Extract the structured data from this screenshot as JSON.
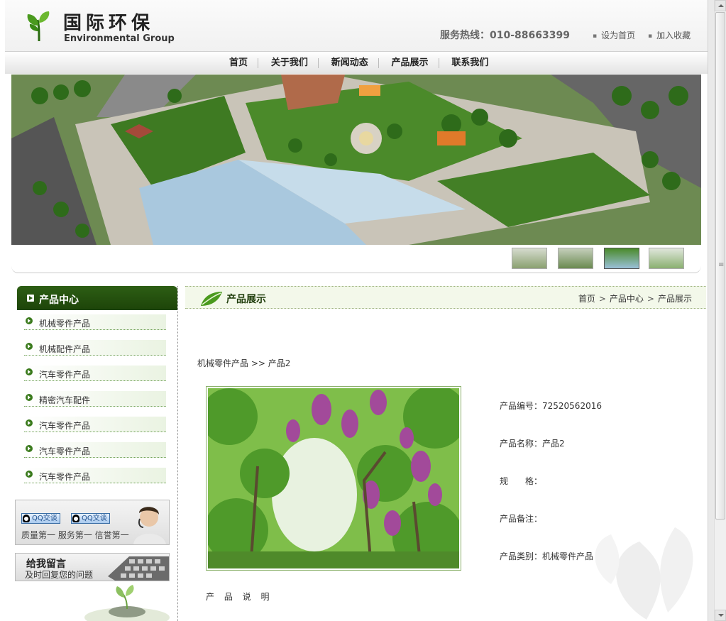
{
  "header": {
    "brand_cn": "国际环保",
    "brand_en": "Environmental Group",
    "hotline": "服务热线：010-88663399",
    "links": [
      "设为首页",
      "加入收藏"
    ]
  },
  "nav": {
    "items": [
      "首页",
      "关于我们",
      "新闻动态",
      "产品展示",
      "联系我们"
    ]
  },
  "sidebar": {
    "title": "产品中心",
    "items": [
      "机械零件产品",
      "机械配件产品",
      "汽车零件产品",
      "精密汽车配件",
      "汽车零件产品",
      "汽车零件产品",
      "汽车零件产品"
    ],
    "qq": {
      "buttons": [
        "QQ交谈",
        "QQ交谈"
      ],
      "slogan": "质量第一 服务第一 信誉第一"
    },
    "message": {
      "title": "给我留言",
      "subtitle": "及时回复您的问题"
    }
  },
  "main": {
    "section_title": "产品展示",
    "breadcrumb": [
      "首页",
      "产品中心",
      "产品展示"
    ],
    "path": "机械零件产品 >> 产品2",
    "product": {
      "code": "产品编号：72520562016",
      "name": "产品名称：产品2",
      "spec": "规　　格：",
      "note": "产品备注：",
      "category": "产品类别：机械零件产品"
    },
    "description_label": "产 品 说 明"
  },
  "colors": {
    "dark_green": "#1d4409",
    "light_green": "#f3f8ea",
    "accent": "#3a7a1c"
  }
}
